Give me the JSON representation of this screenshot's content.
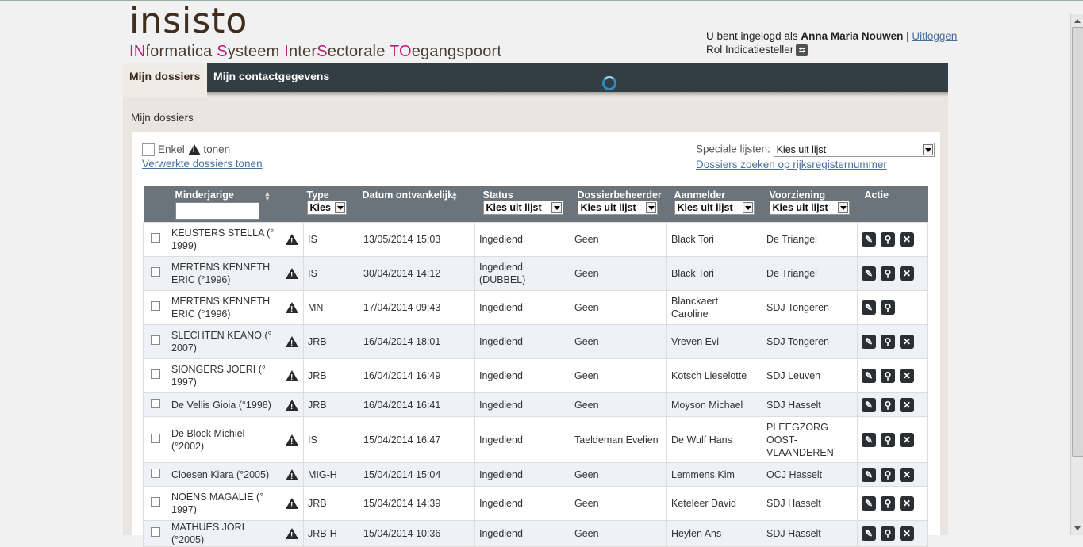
{
  "header": {
    "logo": "insisto",
    "tagline": [
      {
        "t": "IN",
        "pink": true
      },
      {
        "t": "formatica ",
        "pink": false
      },
      {
        "t": "S",
        "pink": true
      },
      {
        "t": "ysteem ",
        "pink": false
      },
      {
        "t": "I",
        "pink": true
      },
      {
        "t": "nter",
        "pink": false
      },
      {
        "t": "S",
        "pink": true
      },
      {
        "t": "ectorale  ",
        "pink": false
      },
      {
        "t": "TO",
        "pink": true
      },
      {
        "t": "egangspoort",
        "pink": false
      }
    ],
    "logged_in_prefix": "U bent ingelogd als ",
    "user_name": "Anna Maria Nouwen",
    "separator": " | ",
    "logout": "Uitloggen",
    "role": "Rol Indicatiesteller"
  },
  "nav": {
    "tab_active": "Mijn dossiers",
    "tab_other": "Mijn contactgegevens"
  },
  "breadcrumb": "Mijn dossiers",
  "filters": {
    "only_label_1": "Enkel",
    "only_label_2": "tonen",
    "processed_link": "Verwerkte dossiers tonen",
    "special_lists_label": "Speciale lijsten:",
    "special_lists_value": "Kies uit lijst",
    "search_link": "Dossiers zoeken op rijksregisternummer"
  },
  "table": {
    "headers": {
      "minor": "Minderjarige",
      "type": "Type",
      "type_select": "Kies",
      "date": "Datum ontvankelijk",
      "status": "Status",
      "status_select": "Kies uit lijst",
      "manager": "Dossierbeheerder",
      "manager_select": "Kies uit lijst",
      "reporter": "Aanmelder",
      "reporter_select": "Kies uit lijst",
      "provision": "Voorziening",
      "provision_select": "Kies uit lijst",
      "action": "Actie"
    },
    "rows": [
      {
        "name": "KEUSTERS STELLA (° 1999)",
        "type": "IS",
        "date": "13/05/2014 15:03",
        "status": "Ingediend",
        "manager": "Geen",
        "reporter": "Black Tori",
        "provision": "De Triangel",
        "delete": true,
        "h": 43
      },
      {
        "name": "MERTENS KENNETH ERIC (°1996)",
        "type": "IS",
        "date": "30/04/2014 14:12",
        "status": "Ingediend (DUBBEL)",
        "manager": "Geen",
        "reporter": "Black Tori",
        "provision": "De Triangel",
        "delete": true,
        "h": 43
      },
      {
        "name": "MERTENS KENNETH ERIC (°1996)",
        "type": "MN",
        "date": "17/04/2014 09:43",
        "status": "Ingediend",
        "manager": "Geen",
        "reporter": "Blanckaert Caroline",
        "provision": "SDJ Tongeren",
        "delete": false,
        "h": 43
      },
      {
        "name": "SLECHTEN KEANO (° 2007)",
        "type": "JRB",
        "date": "16/04/2014 18:01",
        "status": "Ingediend",
        "manager": "Geen",
        "reporter": "Vreven Evi",
        "provision": "SDJ Tongeren",
        "delete": true,
        "h": 43
      },
      {
        "name": "SIONGERS JOERI (° 1997)",
        "type": "JRB",
        "date": "16/04/2014 16:49",
        "status": "Ingediend",
        "manager": "Geen",
        "reporter": "Kotsch Lieselotte",
        "provision": "SDJ Leuven",
        "delete": true,
        "h": 43
      },
      {
        "name": "De Vellis Gioia (°1998)",
        "type": "JRB",
        "date": "16/04/2014 16:41",
        "status": "Ingediend",
        "manager": "Geen",
        "reporter": "Moyson Michael",
        "provision": "SDJ Hasselt",
        "delete": true,
        "h": 30
      },
      {
        "name": "De Block Michiel (°2002)",
        "type": "IS",
        "date": "15/04/2014 16:47",
        "status": "Ingediend",
        "manager": "Taeldeman Evelien",
        "reporter": "De Wulf Hans",
        "provision": "PLEEGZORG OOST-VLAANDEREN",
        "delete": true,
        "h": 58
      },
      {
        "name": "Cloesen Kiara (°2005)",
        "type": "MIG-H",
        "date": "15/04/2014 15:04",
        "status": "Ingediend",
        "manager": "Geen",
        "reporter": "Lemmens Kim",
        "provision": "OCJ Hasselt",
        "delete": true,
        "h": 30
      },
      {
        "name": "NOENS MAGALIE (° 1997)",
        "type": "JRB",
        "date": "15/04/2014 14:39",
        "status": "Ingediend",
        "manager": "Geen",
        "reporter": "Keteleer David",
        "provision": "SDJ Hasselt",
        "delete": true,
        "h": 43
      },
      {
        "name": "MATHUES JORI (°2005)",
        "type": "JRB-H",
        "date": "15/04/2014 10:36",
        "status": "Ingediend",
        "manager": "Geen",
        "reporter": "Heylen Ans",
        "provision": "SDJ Hasselt",
        "delete": true,
        "h": 30
      }
    ]
  }
}
